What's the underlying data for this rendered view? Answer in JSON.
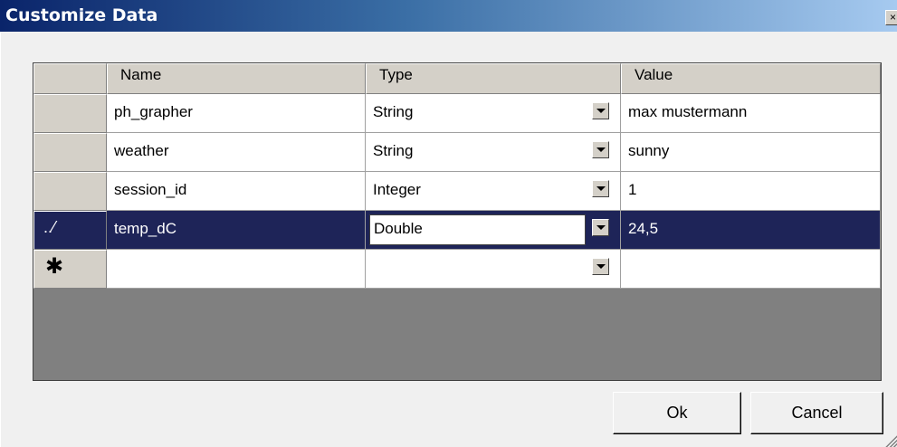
{
  "window": {
    "title": "Customize Data",
    "close_glyph": "×"
  },
  "grid": {
    "columns": [
      "Name",
      "Type",
      "Value"
    ],
    "rows": [
      {
        "name": "ph_grapher",
        "type": "String",
        "value": "max mustermann"
      },
      {
        "name": "weather",
        "type": "String",
        "value": "sunny"
      },
      {
        "name": "session_id",
        "type": "Integer",
        "value": "1"
      },
      {
        "name": "temp_dC",
        "type": "Double",
        "value": "24,5",
        "selected": true,
        "indicator": "edit-pencil-icon"
      }
    ],
    "new_row_indicator": "✱",
    "edit_indicator_glyph": "..⁄"
  },
  "buttons": {
    "ok": "Ok",
    "cancel": "Cancel"
  },
  "colors": {
    "selection": "#1e2458",
    "title_start": "#0a246a",
    "title_end": "#a6caf0"
  }
}
